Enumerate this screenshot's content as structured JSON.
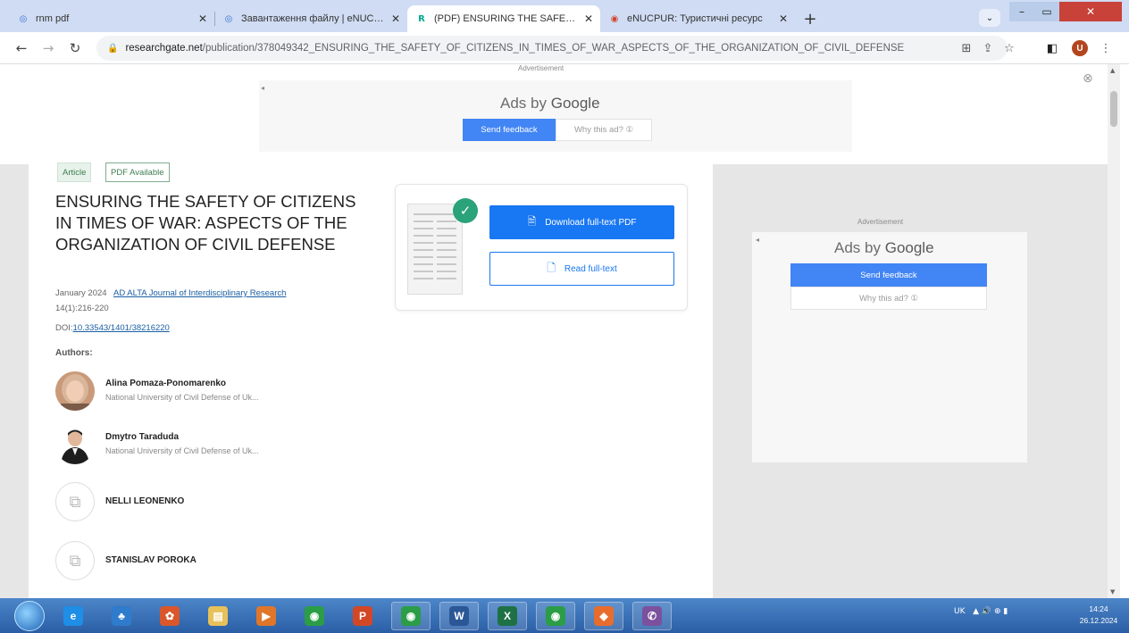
{
  "browser": {
    "tabs": [
      {
        "label": "rnm pdf",
        "icon_color": "#3c6fd6",
        "glyph": "◎"
      },
      {
        "label": "Завантаження файлу | eNUCPU",
        "icon_color": "#3c6fd6",
        "glyph": "◎"
      },
      {
        "label": "(PDF) ENSURING THE SAFETY O",
        "icon_color": "#ffffff",
        "glyph": "R",
        "active": true
      },
      {
        "label": "eNUCPUR: Туристичні ресурс",
        "icon_color": "#d4442c",
        "glyph": "◉"
      }
    ],
    "close_glyph": "✕",
    "new_tab_glyph": "+",
    "url_host": "researchgate.net",
    "url_path": "/publication/378049342_ENSURING_THE_SAFETY_OF_CITIZENS_IN_TIMES_OF_WAR_ASPECTS_OF_THE_ORGANIZATION_OF_CIVIL_DEFENSE",
    "profile_initial": "U"
  },
  "top_ad": {
    "label": "Advertisement",
    "ads_by": "Ads by",
    "google": "Google",
    "send_feedback": "Send feedback",
    "why_this_ad": "Why this ad? ①"
  },
  "article": {
    "badge_type": "Article",
    "badge_pdf": "PDF Available",
    "title": "ENSURING THE SAFETY OF CITIZENS IN TIMES OF WAR: ASPECTS OF THE ORGANIZATION OF CIVIL DEFENSE",
    "date": "January 2024",
    "journal": "AD ALTA Journal of Interdisciplinary Research",
    "volume_pages": "14(1):216-220",
    "doi_prefix": "DOI:",
    "doi": "10.33543/1401/38216220",
    "authors_label": "Authors:",
    "authors": [
      {
        "name": "Alina Pomaza-Ponomarenko",
        "affiliation": "National University of Civil Defense of Uk...",
        "avatar": "photo-female"
      },
      {
        "name": "Dmytro Taraduda",
        "affiliation": "National University of Civil Defense of Uk...",
        "avatar": "photo-male"
      },
      {
        "name": "NELLI LEONENKO",
        "affiliation": "",
        "avatar": "placeholder"
      },
      {
        "name": "STANISLAV POROKA",
        "affiliation": "",
        "avatar": "placeholder"
      }
    ]
  },
  "actions": {
    "download": "Download full-text PDF",
    "read": "Read full-text"
  },
  "side_ad": {
    "label": "Advertisement",
    "ads_by": "Ads by",
    "google": "Google",
    "send_feedback": "Send feedback",
    "why_this_ad": "Why this ad? ①"
  },
  "taskbar": {
    "apps": [
      {
        "name": "ie",
        "glyph": "e",
        "color": "#1e8ee6"
      },
      {
        "name": "network",
        "glyph": "♣",
        "color": "#2f7bcc"
      },
      {
        "name": "paint",
        "glyph": "✿",
        "color": "#d9572b"
      },
      {
        "name": "explorer",
        "glyph": "▤",
        "color": "#e8c15a"
      },
      {
        "name": "media",
        "glyph": "▶",
        "color": "#e0762a"
      },
      {
        "name": "chrome",
        "glyph": "◉",
        "color": "#2b9d47"
      },
      {
        "name": "powerpoint",
        "glyph": "P",
        "color": "#d24726"
      },
      {
        "name": "chrome-2",
        "glyph": "◉",
        "color": "#2b9d47"
      },
      {
        "name": "word",
        "glyph": "W",
        "color": "#2b5797"
      },
      {
        "name": "excel",
        "glyph": "X",
        "color": "#1e7145"
      },
      {
        "name": "chrome-3",
        "glyph": "◉",
        "color": "#2b9d47"
      },
      {
        "name": "app-orange",
        "glyph": "◆",
        "color": "#e86d2c"
      },
      {
        "name": "viber",
        "glyph": "✆",
        "color": "#7b519d"
      }
    ],
    "tray_lang": "UK",
    "tray_icons": "▲ 🔊 ⊕ ▮",
    "time": "14:24",
    "date": "26.12.2024"
  }
}
